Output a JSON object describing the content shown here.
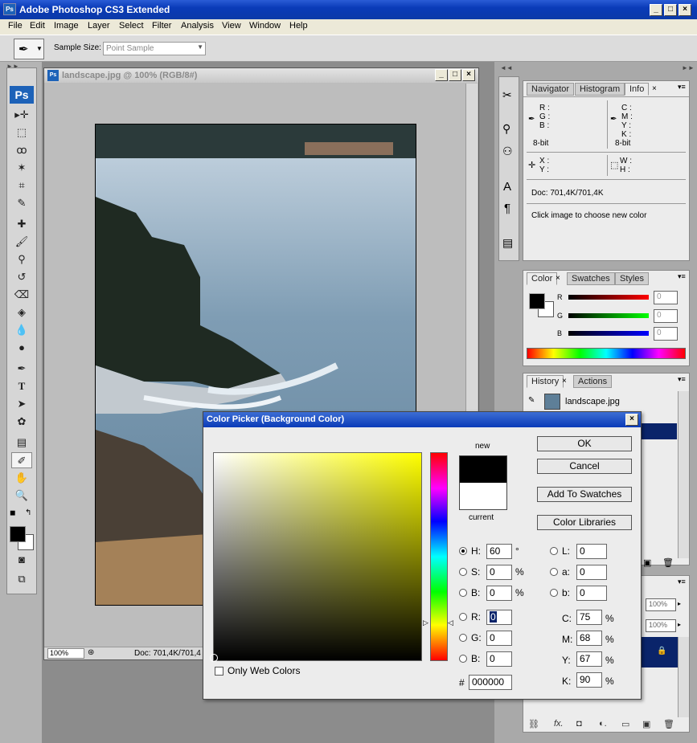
{
  "window": {
    "title": "Adobe Photoshop CS3 Extended",
    "app_icon": "Ps"
  },
  "menu": [
    "File",
    "Edit",
    "Image",
    "Layer",
    "Select",
    "Filter",
    "Analysis",
    "View",
    "Window",
    "Help"
  ],
  "options_bar": {
    "sample_size_label": "Sample Size:",
    "sample_size_value": "Point Sample"
  },
  "tools_logo": "Ps",
  "document": {
    "title": "landscape.jpg @ 100% (RGB/8#)",
    "zoom": "100%",
    "doc_status": "Doc: 701,4K/701,4"
  },
  "info_panel": {
    "tabs": [
      "Navigator",
      "Histogram",
      "Info"
    ],
    "rgb_labels": [
      "R :",
      "G :",
      "B :"
    ],
    "cmyk_labels": [
      "C :",
      "M :",
      "Y :",
      "K :"
    ],
    "bit_left": "8-bit",
    "bit_right": "8-bit",
    "xy_labels": [
      "X :",
      "Y :"
    ],
    "wh_labels": [
      "W :",
      "H :"
    ],
    "doc": "Doc: 701,4K/701,4K",
    "hint": "Click image to choose new color"
  },
  "color_panel": {
    "tabs": [
      "Color",
      "Swatches",
      "Styles"
    ],
    "r_label": "R",
    "g_label": "G",
    "b_label": "B",
    "r": "0",
    "g": "0",
    "b": "0"
  },
  "history_panel": {
    "tabs": [
      "History",
      "Actions"
    ],
    "item": "landscape.jpg"
  },
  "layers_panel": {
    "opacity": "100%",
    "fill": "100%"
  },
  "color_picker": {
    "title": "Color Picker (Background Color)",
    "new_label": "new",
    "current_label": "current",
    "ok": "OK",
    "cancel": "Cancel",
    "add_swatches": "Add To Swatches",
    "color_libraries": "Color Libraries",
    "only_web": "Only Web Colors",
    "hsb": [
      {
        "label": "H:",
        "value": "60",
        "unit": "°"
      },
      {
        "label": "S:",
        "value": "0",
        "unit": "%"
      },
      {
        "label": "B:",
        "value": "0",
        "unit": "%"
      }
    ],
    "rgb": [
      {
        "label": "R:",
        "value": "0"
      },
      {
        "label": "G:",
        "value": "0"
      },
      {
        "label": "B:",
        "value": "0"
      }
    ],
    "lab": [
      {
        "label": "L:",
        "value": "0"
      },
      {
        "label": "a:",
        "value": "0"
      },
      {
        "label": "b:",
        "value": "0"
      }
    ],
    "cmyk": [
      {
        "label": "C:",
        "value": "75",
        "unit": "%"
      },
      {
        "label": "M:",
        "value": "68",
        "unit": "%"
      },
      {
        "label": "Y:",
        "value": "67",
        "unit": "%"
      },
      {
        "label": "K:",
        "value": "90",
        "unit": "%"
      }
    ],
    "hex_label": "#",
    "hex": "000000",
    "hue_color": "#ffff00",
    "new_color": "#000000",
    "current_color": "#ffffff"
  }
}
